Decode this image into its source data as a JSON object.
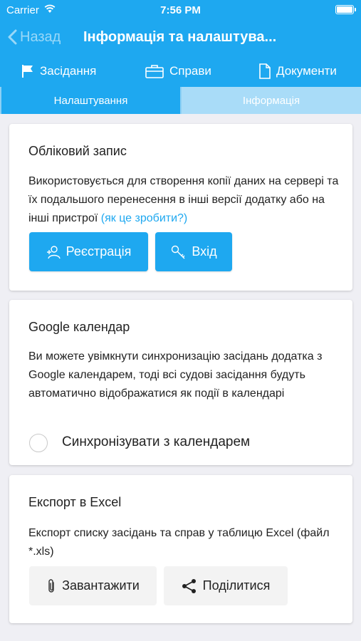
{
  "status_bar": {
    "carrier": "Carrier",
    "time": "7:56 PM"
  },
  "nav": {
    "back_label": "Назад",
    "title": "Інформація та налаштува..."
  },
  "top_tabs": [
    {
      "label": "Засідання",
      "icon": "flag-icon"
    },
    {
      "label": "Справи",
      "icon": "briefcase-icon"
    },
    {
      "label": "Документи",
      "icon": "document-icon"
    }
  ],
  "segments": {
    "settings": "Налаштування",
    "info": "Інформація",
    "selected": "Налаштування"
  },
  "account": {
    "title": "Обліковий запис",
    "text": "Використовується для створення копії даних на сервері та їх подальшого перенесення в інші версії додатку або на інші пристрої",
    "link": "(як це зробити?)",
    "register_label": "Реєстрація",
    "login_label": "Вхід"
  },
  "calendar": {
    "title": "Google календар",
    "text": "Ви можете увімкнути синхронизацію засідань додатка з Google календарем, тоді всі судові засідання будуть автоматично відображатися як події в календарі",
    "sync_label": "Синхронізувати з календарем",
    "sync_enabled": false
  },
  "export": {
    "title": "Експорт в Excel",
    "text": "Експорт списку засідань та справ у таблицю Excel (файл *.xls)",
    "download_label": "Завантажити",
    "share_label": "Поділитися"
  },
  "colors": {
    "accent": "#1ea8f0",
    "segment_inactive": "#a9dcf8",
    "background": "#efeff4"
  }
}
